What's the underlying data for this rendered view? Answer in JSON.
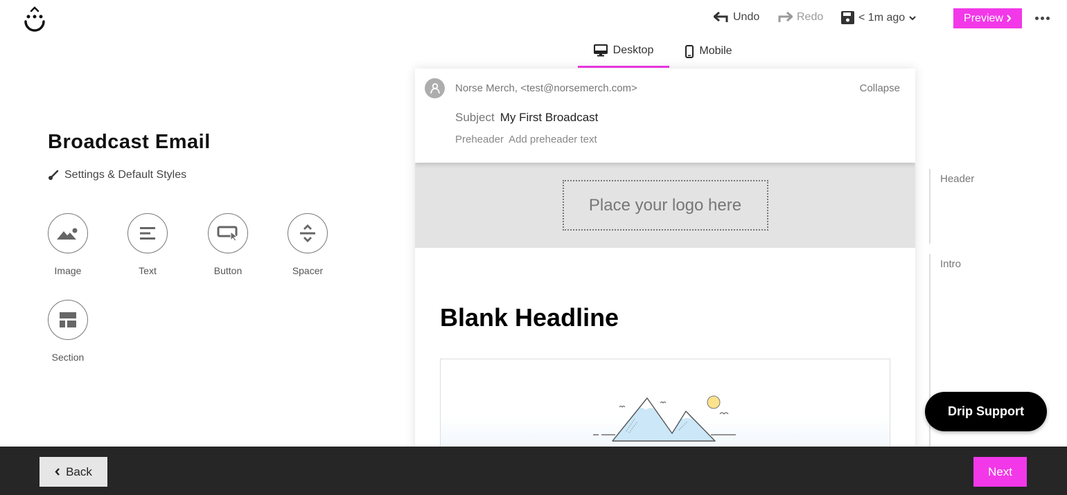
{
  "app": {
    "logo_icon": "drip-smile-logo"
  },
  "toolbar": {
    "undo_label": "Undo",
    "redo_label": "Redo",
    "save_status": "< 1m ago",
    "preview_label": "Preview",
    "more_icon": "more-horizontal-icon",
    "accent_color": "#f238e8"
  },
  "device_tabs": [
    {
      "label": "Desktop",
      "icon": "desktop-icon",
      "active": true
    },
    {
      "label": "Mobile",
      "icon": "mobile-icon",
      "active": false
    }
  ],
  "left_panel": {
    "title": "Broadcast Email",
    "settings_label": "Settings & Default Styles",
    "blocks": [
      {
        "label": "Image",
        "icon": "image-icon"
      },
      {
        "label": "Text",
        "icon": "text-icon"
      },
      {
        "label": "Button",
        "icon": "button-icon"
      },
      {
        "label": "Spacer",
        "icon": "spacer-icon"
      },
      {
        "label": "Section",
        "icon": "section-icon"
      }
    ]
  },
  "email": {
    "from": "Norse Merch, <test@norsemerch.com>",
    "collapse_label": "Collapse",
    "subject_key": "Subject",
    "subject_value": "My First Broadcast",
    "preheader_key": "Preheader",
    "preheader_placeholder": "Add preheader text",
    "logo_placeholder": "Place your logo here",
    "headline": "Blank Headline"
  },
  "sections_rail": [
    {
      "label": "Header"
    },
    {
      "label": "Intro"
    }
  ],
  "support": {
    "label": "Drip Support"
  },
  "footer": {
    "back_label": "Back",
    "next_label": "Next"
  }
}
